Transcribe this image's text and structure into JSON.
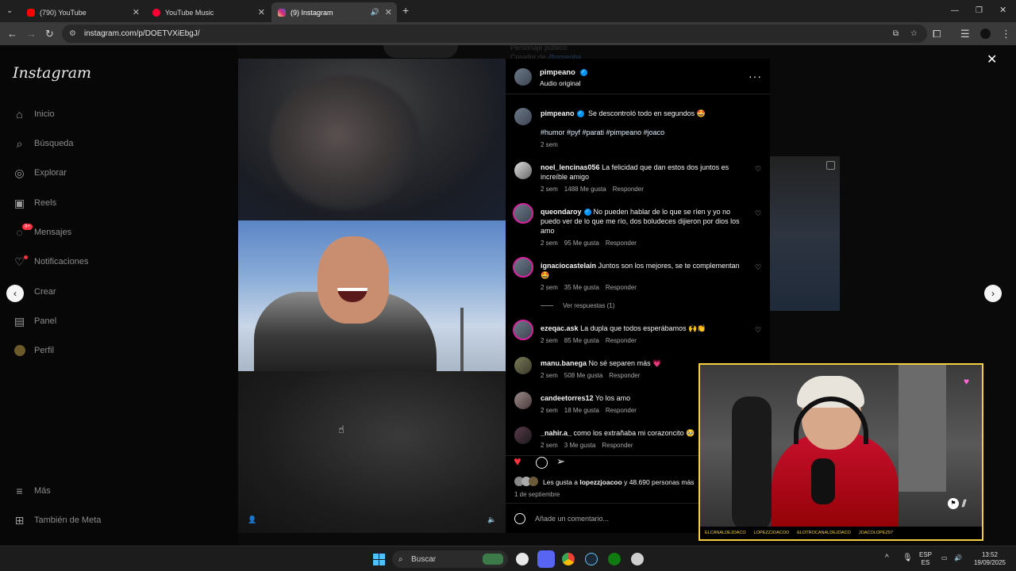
{
  "browser": {
    "tabs": [
      {
        "title": "(790) YouTube",
        "color": "#ff0000"
      },
      {
        "title": "YouTube Music",
        "color": "#ff0033"
      },
      {
        "title": "(9) Instagram",
        "color": "#d6249f"
      }
    ],
    "url": "instagram.com/p/DOETVXiEbgJ/"
  },
  "sidebar": {
    "logo": "Instagram",
    "items": [
      {
        "label": "Inicio",
        "icon": "home-icon"
      },
      {
        "label": "Búsqueda",
        "icon": "search-icon"
      },
      {
        "label": "Explorar",
        "icon": "compass-icon"
      },
      {
        "label": "Reels",
        "icon": "reels-icon"
      },
      {
        "label": "Mensajes",
        "icon": "messenger-icon"
      },
      {
        "label": "Notificaciones",
        "icon": "heart-icon"
      },
      {
        "label": "Crear",
        "icon": "plus-icon"
      },
      {
        "label": "Panel",
        "icon": "chart-icon"
      },
      {
        "label": "Perfil",
        "icon": "avatar-icon"
      }
    ],
    "messages_badge": "9+",
    "more": "Más",
    "meta": "También de Meta"
  },
  "background": {
    "line1": "Personaje público",
    "line2": "Creador de",
    "line2_link": "@spreoba"
  },
  "post": {
    "author": "pimpeano",
    "audio": "Audio original",
    "caption": "Se descontroló todo en segundos 🤩",
    "hashtags": "#humor #pyf #parati #pimpeano #joaco",
    "time": "2 sem",
    "comments": [
      {
        "user": "noel_lencinas056",
        "verified": false,
        "text": "La felicidad que dan estos dos juntos es increíble amigo",
        "time": "2 sem",
        "likes": "1488 Me gusta",
        "reply": "Responder"
      },
      {
        "user": "queondaroy",
        "verified": true,
        "text": "No pueden hablar de lo que se ríen y yo no puedo ver de lo que me río, dos boludeces dijieron por dios los amo",
        "time": "2 sem",
        "likes": "95 Me gusta",
        "reply": "Responder"
      },
      {
        "user": "ignaciocastelain",
        "verified": false,
        "text": "Juntos son los mejores, se te complementan 🤩",
        "time": "2 sem",
        "likes": "35 Me gusta",
        "reply": "Responder"
      },
      {
        "user": "ezeqac.ask",
        "verified": false,
        "text": "La dupla que todos esperábamos 🙌👏",
        "time": "2 sem",
        "likes": "85 Me gusta",
        "reply": "Responder"
      },
      {
        "user": "manu.banega",
        "verified": false,
        "text": "No sé separen más 💗",
        "time": "2 sem",
        "likes": "508 Me gusta",
        "reply": "Responder"
      },
      {
        "user": "candeetorres12",
        "verified": false,
        "text": "Yo los amo",
        "time": "2 sem",
        "likes": "18 Me gusta",
        "reply": "Responder"
      },
      {
        "user": "_nahir.a_",
        "verified": false,
        "text": "como los extrañaba mi corazoncito 🥹",
        "time": "2 sem",
        "likes": "3 Me gusta",
        "reply": "Responder"
      }
    ],
    "view_replies": "Ver respuestas (1)",
    "likes_prefix": "Les gusta a",
    "likes_user": "lopezzjoacoo",
    "likes_suffix": "y 48.690 personas más",
    "date": "1 de septiembre",
    "comment_placeholder": "Añade un comentario..."
  },
  "stream": {
    "ticker": [
      "ELCANALDEJOACO",
      "LOPEZZJOACOO",
      "ELOTROCANALDEJOACO",
      "JOACOLOPEZ97"
    ]
  },
  "taskbar": {
    "search": "Buscar",
    "lang": "ESP",
    "lang2": "ES",
    "time": "13:52",
    "date": "19/09/2025"
  }
}
